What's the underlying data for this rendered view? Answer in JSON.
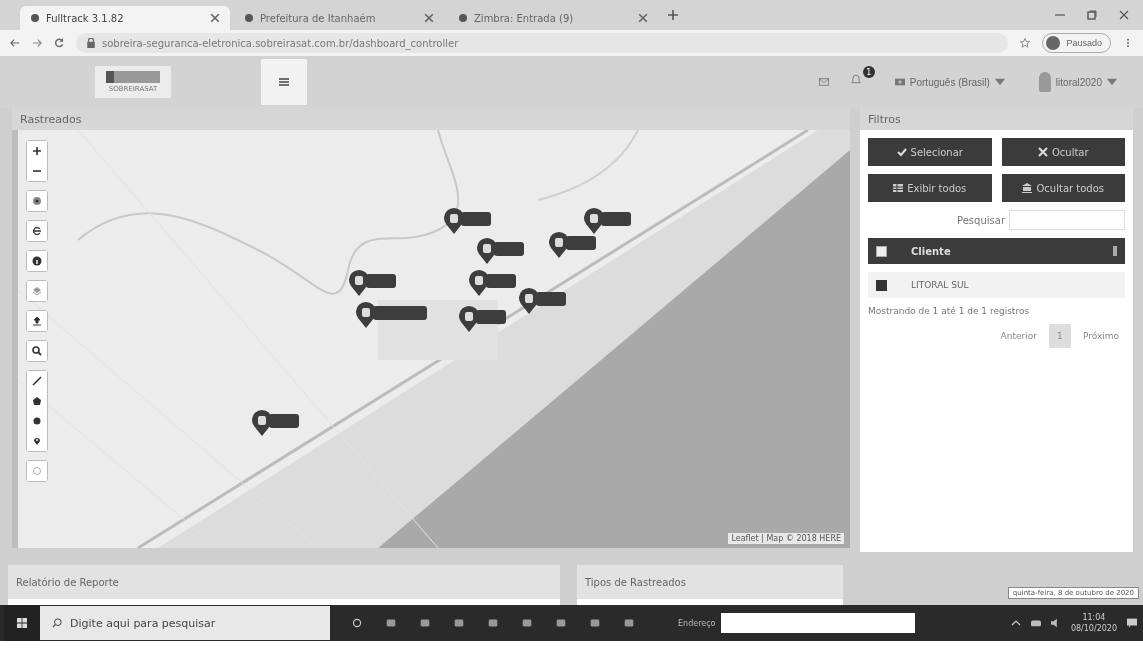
{
  "browser": {
    "tabs": [
      {
        "title": "Fulltrack 3.1.82",
        "selected": true
      },
      {
        "title": "Prefeitura de Itanhaém",
        "selected": false
      },
      {
        "title": "Zimbra: Entrada (9)",
        "selected": false
      }
    ],
    "url": "sobreira-seguranca-eletronica.sobreirasat.com.br/dashboard_controller",
    "profile": "Pausado"
  },
  "header": {
    "logo_caption": "SOBREIRASAT",
    "notifications": "1",
    "language": "Português (Brasil)",
    "user": "litoral2020"
  },
  "map_panel": {
    "title": "Rastreados",
    "attribution": "Leaflet | Map © 2018 HERE"
  },
  "filters": {
    "title": "Filtros",
    "buttons": [
      {
        "label": "Selecionar",
        "kind": "check"
      },
      {
        "label": "Ocultar",
        "kind": "times"
      },
      {
        "label": "Exibir todos",
        "kind": "grid"
      },
      {
        "label": "Ocultar todos",
        "kind": "bank"
      }
    ],
    "search_label": "Pesquisar",
    "table": {
      "header_checked": false,
      "column": "Cliente",
      "rows": [
        {
          "name": "LITORAL SUL",
          "checked": true
        }
      ]
    },
    "info": "Mostrando de 1 até 1 de 1 registros",
    "pagination": {
      "prev": "Anterior",
      "pages": [
        {
          "label": "1",
          "selected": true
        }
      ],
      "next": "Próximo"
    }
  },
  "panels": [
    {
      "title": "Relatório de Reporte"
    },
    {
      "title": "Tipos de Rastreados"
    }
  ],
  "taskbar": {
    "search_placeholder": "Digite aqui para pesquisar",
    "address_label": "Endereço",
    "time": "11:04",
    "date": "08/10/2020",
    "tooltip": "quinta-feira, 8 de outubro de 2020"
  }
}
